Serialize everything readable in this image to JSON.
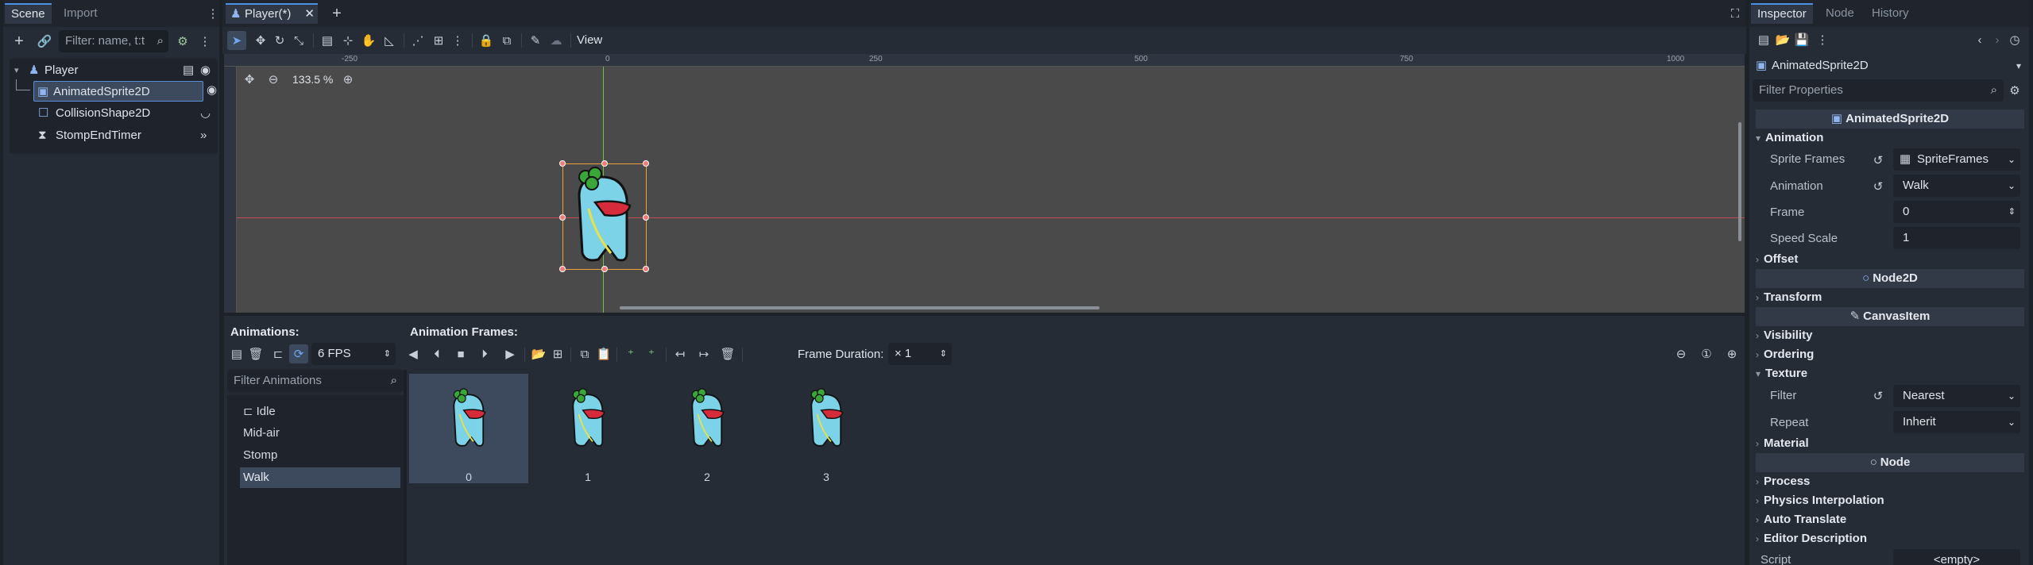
{
  "scene_dock": {
    "tabs": [
      "Scene",
      "Import"
    ],
    "filter_placeholder": "Filter: name, t:t",
    "tree": [
      {
        "name": "Player"
      },
      {
        "name": "AnimatedSprite2D"
      },
      {
        "name": "CollisionShape2D"
      },
      {
        "name": "StompEndTimer"
      }
    ]
  },
  "editor": {
    "scene_tab": "Player(*)",
    "view_menu": "View",
    "zoom": "133.5 %",
    "ruler_labels": [
      "-250",
      "0",
      "250",
      "500",
      "750",
      "1000"
    ]
  },
  "animation_panel": {
    "animations_label": "Animations:",
    "frames_label": "Animation Frames:",
    "fps": "6 FPS",
    "frame_duration_label": "Frame Duration:",
    "frame_duration_value": "× 1",
    "filter_placeholder": "Filter Animations",
    "animations": [
      "Idle",
      "Mid-air",
      "Stomp",
      "Walk"
    ],
    "selected_animation": "Walk",
    "frames": [
      "0",
      "1",
      "2",
      "3"
    ]
  },
  "inspector": {
    "tabs": [
      "Inspector",
      "Node",
      "History"
    ],
    "node_selector": "AnimatedSprite2D",
    "filter_placeholder": "Filter Properties",
    "class_header": "AnimatedSprite2D",
    "animation_section": "Animation",
    "props": {
      "sprite_frames_label": "Sprite Frames",
      "sprite_frames_value": "SpriteFrames",
      "animation_label": "Animation",
      "animation_value": "Walk",
      "frame_label": "Frame",
      "frame_value": "0",
      "speed_scale_label": "Speed Scale",
      "speed_scale_value": "1"
    },
    "offset_section": "Offset",
    "node2d_header": "Node2D",
    "transform_section": "Transform",
    "canvasitem_header": "CanvasItem",
    "visibility_section": "Visibility",
    "ordering_section": "Ordering",
    "texture_section": "Texture",
    "filter_label": "Filter",
    "filter_value": "Nearest",
    "repeat_label": "Repeat",
    "repeat_value": "Inherit",
    "material_section": "Material",
    "node_header": "Node",
    "process_section": "Process",
    "physics_interp_section": "Physics Interpolation",
    "auto_translate_section": "Auto Translate",
    "editor_desc_section": "Editor Description",
    "script_label": "Script",
    "script_value": "<empty>"
  },
  "colors": {
    "accent": "#4a8fe0",
    "selection": "#3d4a5e",
    "viewport_bg": "#4a4a4a",
    "sprite_body": "#7cd3e8",
    "sprite_mouth": "#d62b3a",
    "sprite_leaf": "#3aa63a"
  }
}
